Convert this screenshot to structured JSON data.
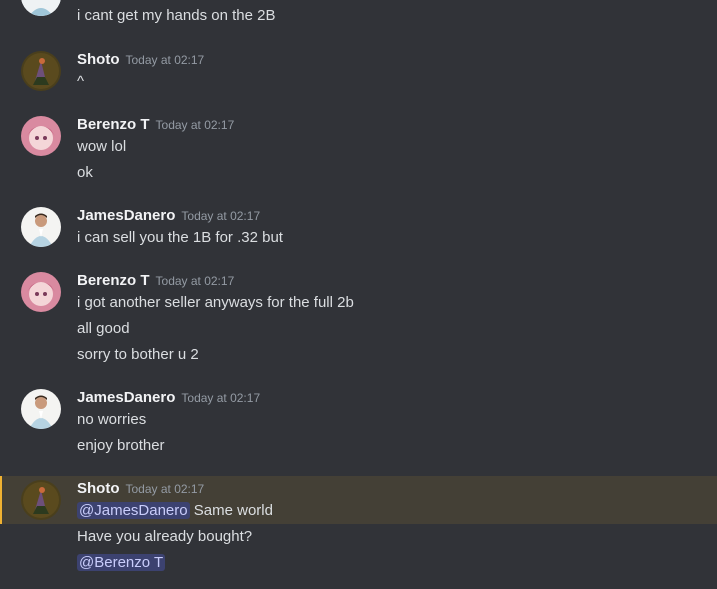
{
  "messages": [
    {
      "author": "Shoto",
      "timestamp": "Today at 02:17",
      "lines": [
        "^"
      ]
    },
    {
      "author": "Berenzo T",
      "timestamp": "Today at 02:17",
      "lines": [
        "wow lol",
        "ok"
      ]
    },
    {
      "author": "JamesDanero",
      "timestamp": "Today at 02:17",
      "lines": [
        "i can sell you the 1B for .32 but"
      ]
    },
    {
      "author": "Berenzo T",
      "timestamp": "Today at 02:17",
      "lines": [
        "i got another seller anyways for the full 2b",
        "all good",
        "sorry to bother u 2"
      ]
    },
    {
      "author": "JamesDanero",
      "timestamp": "Today at 02:17",
      "lines": [
        "no worries",
        "enjoy brother"
      ]
    },
    {
      "author": "Shoto",
      "timestamp": "Today at 02:17",
      "mention1": "@JamesDanero",
      "line1_rest": " Same world",
      "line2": "Have you already bought?",
      "mention2": "@Berenzo T"
    }
  ],
  "top_line": "i cant get my hands on the 2B",
  "colors": {
    "background": "#313338",
    "highlight_bg": "#444036",
    "highlight_bar": "#f0b232",
    "mention_bg": "#3c4270",
    "mention_text": "#c9cdfb"
  },
  "avatars": {
    "Shoto": "dark-olive-character-avatar",
    "Berenzo T": "pink-anime-avatar",
    "JamesDanero": "man-in-suit-avatar"
  }
}
